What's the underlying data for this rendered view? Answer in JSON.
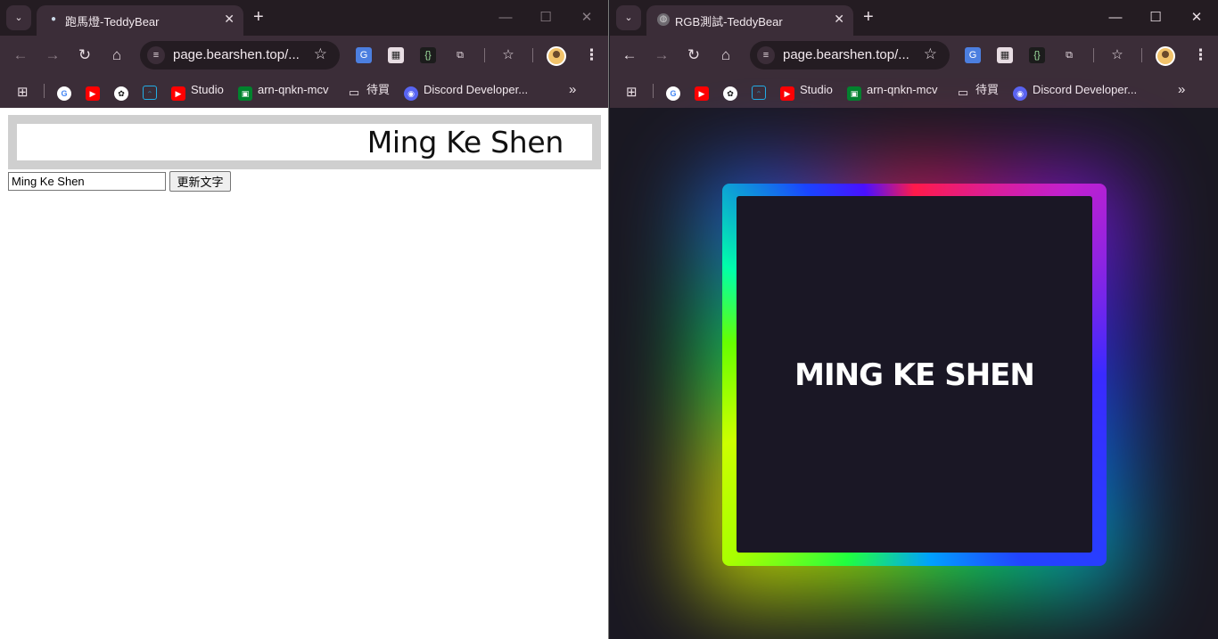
{
  "left_window": {
    "tab": {
      "title": "跑馬燈-TeddyBear"
    },
    "omnibox": {
      "url": "page.bearshen.top/..."
    },
    "bookmarks": [
      "Studio",
      "arn-qnkn-mcv",
      "待買",
      "Discord Developer..."
    ],
    "page": {
      "marquee_text": "Ming Ke Shen",
      "input_value": "Ming Ke Shen",
      "button_label": "更新文字"
    }
  },
  "right_window": {
    "tab": {
      "title": "RGB測試-TeddyBear"
    },
    "omnibox": {
      "url": "page.bearshen.top/..."
    },
    "bookmarks": [
      "Studio",
      "arn-qnkn-mcv",
      "待買",
      "Discord Developer..."
    ],
    "page": {
      "rgb_text": "MING KE SHEN"
    }
  },
  "colors": {
    "tabstrip": "#241c22",
    "toolbar": "#3b2d38",
    "rgb_page_bg": "#1a1822"
  }
}
